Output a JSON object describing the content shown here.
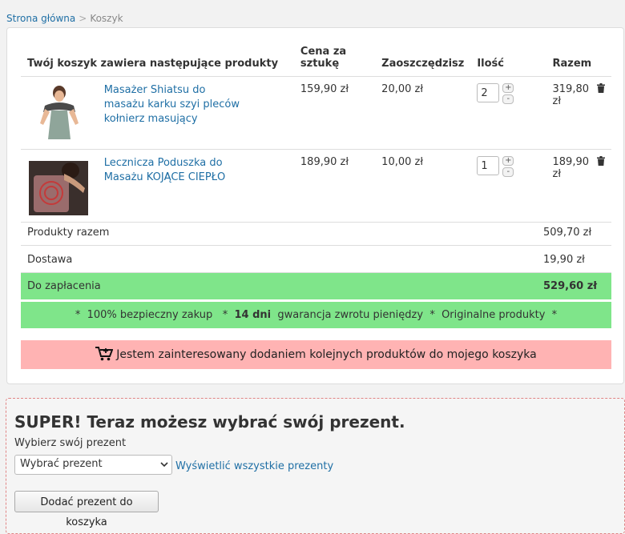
{
  "breadcrumb": {
    "home": "Strona główna",
    "sep": ">",
    "current": "Koszyk"
  },
  "cart": {
    "headers": {
      "products": "Twój koszyk zawiera następujące produkty",
      "price": "Cena za sztukę",
      "saved": "Zaoszczędzisz",
      "qty": "Ilość",
      "total": "Razem"
    },
    "items": [
      {
        "name": "Masażer Shiatsu do masażu karku szyi pleców kołnierz masujący",
        "price": "159,90 zł",
        "saved": "20,00 zł",
        "qty": "2",
        "total": "319,80 zł"
      },
      {
        "name": "Lecznicza Poduszka do Masażu KOJĄCE CIEPŁO",
        "price": "189,90 zł",
        "saved": "10,00 zł",
        "qty": "1",
        "total": "189,90 zł"
      }
    ],
    "qty_plus": "+",
    "qty_minus": "-",
    "summary": {
      "products_label": "Produkty razem",
      "products_value": "509,70 zł",
      "shipping_label": "Dostawa",
      "shipping_value": "19,90 zł",
      "pay_label": "Do zapłacenia",
      "pay_value": "529,60 zł"
    },
    "guarantee": {
      "star": "*",
      "part1": "100% bezpieczny zakup",
      "days": "14 dni",
      "part2": "gwarancja zwrotu pieniędzy",
      "part3": "Originalne produkty"
    },
    "interest_button": "Jestem zainteresowany dodaniem kolejnych produktów do mojego koszyka"
  },
  "gift": {
    "title": "SUPER! Teraz możesz wybrać swój prezent.",
    "label": "Wybierz swój prezent",
    "select_value": "Wybrać prezent",
    "show_all_link": "Wyświetlić wszystkie prezenty",
    "add_button": "Dodać prezent do koszyka"
  },
  "colors": {
    "green": "#7fe58a",
    "pink": "#ffb3b3",
    "link": "#1f6fa5"
  }
}
